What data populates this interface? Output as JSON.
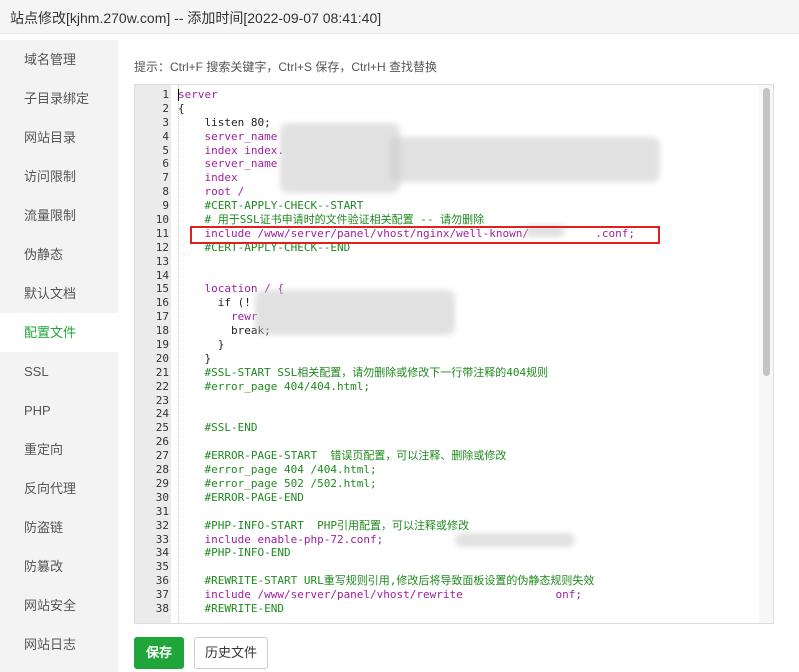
{
  "window": {
    "title": "站点修改[kjhm.270w.com] -- 添加时间[2022-09-07 08:41:40]"
  },
  "sidebar": {
    "active_index": 7,
    "items": [
      {
        "label": "域名管理"
      },
      {
        "label": "子目录绑定"
      },
      {
        "label": "网站目录"
      },
      {
        "label": "访问限制"
      },
      {
        "label": "流量限制"
      },
      {
        "label": "伪静态"
      },
      {
        "label": "默认文档"
      },
      {
        "label": "配置文件"
      },
      {
        "label": "SSL"
      },
      {
        "label": "PHP"
      },
      {
        "label": "重定向"
      },
      {
        "label": "反向代理"
      },
      {
        "label": "防盗链"
      },
      {
        "label": "防篡改"
      },
      {
        "label": "网站安全"
      },
      {
        "label": "网站日志"
      }
    ]
  },
  "main": {
    "tip": "提示：Ctrl+F 搜索关键字，Ctrl+S 保存，Ctrl+H 查找替换",
    "save_label": "保存",
    "history_label": "历史文件"
  },
  "editor": {
    "lines": [
      {
        "n": "1",
        "t": "server",
        "c": "kw"
      },
      {
        "n": "2",
        "t": "{",
        "c": "plain"
      },
      {
        "n": "3",
        "t": "    listen 80;",
        "c": "plain"
      },
      {
        "n": "4",
        "t": "    server_name",
        "c": "kw"
      },
      {
        "n": "5",
        "t": "    index index.",
        "c": "kw"
      },
      {
        "n": "6",
        "t": "    server_name",
        "c": "kw"
      },
      {
        "n": "7",
        "t": "    index",
        "c": "kw"
      },
      {
        "n": "8",
        "t": "    root /",
        "c": "kw"
      },
      {
        "n": "9",
        "t": "    #CERT-APPLY-CHECK--START",
        "c": "cmt"
      },
      {
        "n": "10",
        "t": "    # 用于SSL证书申请时的文件验证相关配置 -- 请勿删除",
        "c": "cmt"
      },
      {
        "n": "11",
        "t": "    include /www/server/panel/vhost/nginx/well-known/          .conf;",
        "c": "kw"
      },
      {
        "n": "12",
        "t": "    #CERT-APPLY-CHECK--END",
        "c": "cmt"
      },
      {
        "n": "13",
        "t": "",
        "c": "plain"
      },
      {
        "n": "14",
        "t": "",
        "c": "plain"
      },
      {
        "n": "15",
        "t": "    location / {",
        "c": "kw"
      },
      {
        "n": "16",
        "t": "      if (!",
        "c": "plain"
      },
      {
        "n": "17",
        "t": "        rewr",
        "c": "kw"
      },
      {
        "n": "18",
        "t": "        break;",
        "c": "plain"
      },
      {
        "n": "19",
        "t": "      }",
        "c": "plain"
      },
      {
        "n": "20",
        "t": "    }",
        "c": "plain"
      },
      {
        "n": "21",
        "t": "    #SSL-START SSL相关配置，请勿删除或修改下一行带注释的404规则",
        "c": "cmt"
      },
      {
        "n": "22",
        "t": "    #error_page 404/404.html;",
        "c": "cmt"
      },
      {
        "n": "23",
        "t": "",
        "c": "plain"
      },
      {
        "n": "24",
        "t": "",
        "c": "plain"
      },
      {
        "n": "25",
        "t": "    #SSL-END",
        "c": "cmt"
      },
      {
        "n": "26",
        "t": "",
        "c": "plain"
      },
      {
        "n": "27",
        "t": "    #ERROR-PAGE-START  错误页配置，可以注释、删除或修改",
        "c": "cmt"
      },
      {
        "n": "28",
        "t": "    #error_page 404 /404.html;",
        "c": "cmt"
      },
      {
        "n": "29",
        "t": "    #error_page 502 /502.html;",
        "c": "cmt"
      },
      {
        "n": "30",
        "t": "    #ERROR-PAGE-END",
        "c": "cmt"
      },
      {
        "n": "31",
        "t": "",
        "c": "plain"
      },
      {
        "n": "32",
        "t": "    #PHP-INFO-START  PHP引用配置，可以注释或修改",
        "c": "cmt"
      },
      {
        "n": "33",
        "t": "    include enable-php-72.conf;",
        "c": "kw"
      },
      {
        "n": "34",
        "t": "    #PHP-INFO-END",
        "c": "cmt"
      },
      {
        "n": "35",
        "t": "",
        "c": "plain"
      },
      {
        "n": "36",
        "t": "    #REWRITE-START URL重写规则引用,修改后将导致面板设置的伪静态规则失效",
        "c": "cmt"
      },
      {
        "n": "37",
        "t": "    include /www/server/panel/vhost/rewrite              onf;",
        "c": "kw"
      },
      {
        "n": "38",
        "t": "    #REWRITE-END",
        "c": "cmt"
      }
    ]
  },
  "colors": {
    "accent": "#20a53a",
    "highlight_box": "#e02020",
    "comment": "#1f8a1f",
    "keyword": "#a020a0"
  }
}
